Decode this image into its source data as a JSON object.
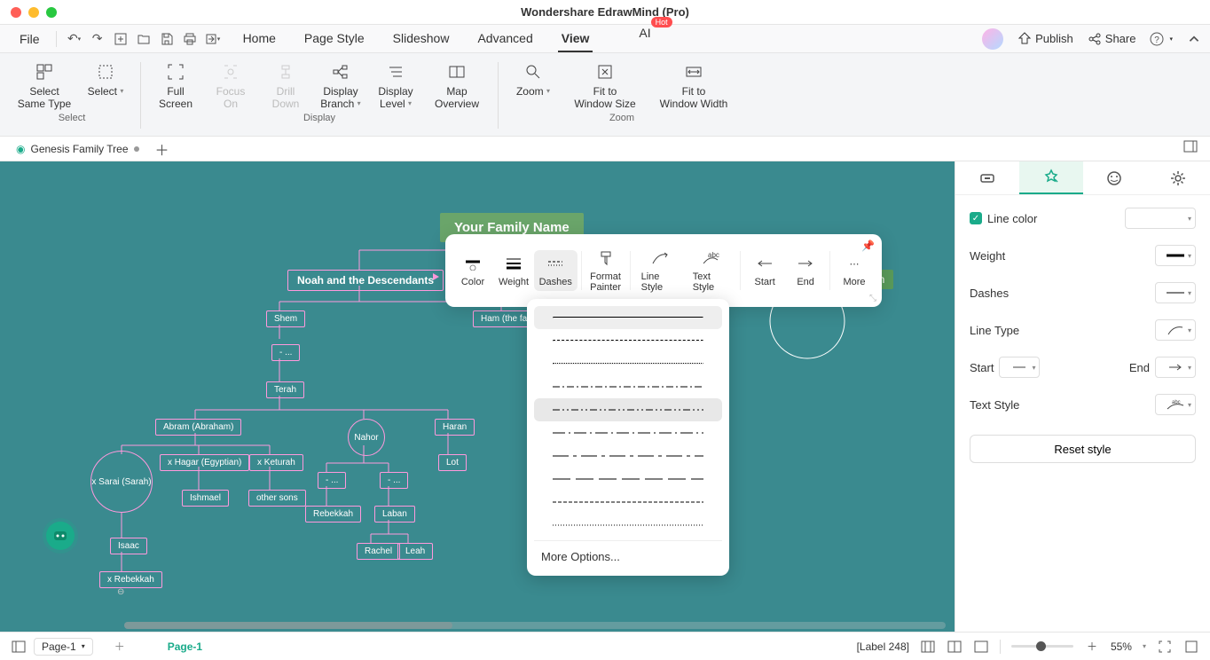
{
  "app_title": "Wondershare EdrawMind (Pro)",
  "menu": {
    "file": "File",
    "tabs": [
      "Home",
      "Page Style",
      "Slideshow",
      "Advanced",
      "View",
      "AI"
    ],
    "active_tab": "View",
    "ai_badge": "Hot",
    "publish": "Publish",
    "share": "Share"
  },
  "ribbon": {
    "groups": [
      {
        "label": "Select",
        "items": [
          {
            "label": "Select\nSame Type",
            "icon": "select-same"
          },
          {
            "label": "Select",
            "icon": "select",
            "caret": true
          }
        ]
      },
      {
        "label": "Display",
        "items": [
          {
            "label": "Full\nScreen",
            "icon": "fullscreen"
          },
          {
            "label": "Focus\nOn",
            "icon": "focus",
            "disabled": true
          },
          {
            "label": "Drill\nDown",
            "icon": "drill",
            "disabled": true
          },
          {
            "label": "Display\nBranch",
            "icon": "branch",
            "caret": true
          },
          {
            "label": "Display\nLevel",
            "icon": "level",
            "caret": true
          },
          {
            "label": "Map\nOverview",
            "icon": "overview"
          }
        ]
      },
      {
        "label": "Zoom",
        "items": [
          {
            "label": "Zoom",
            "icon": "zoom",
            "caret": true
          },
          {
            "label": "Fit to\nWindow Size",
            "icon": "fit-size"
          },
          {
            "label": "Fit to\nWindow Width",
            "icon": "fit-width"
          }
        ]
      }
    ]
  },
  "doc_tab": {
    "name": "Genesis Family Tree",
    "modified": true
  },
  "canvas": {
    "root": "Your Family Name",
    "major": [
      "Noah and the Descendants"
    ],
    "right_hidden": "on",
    "nodes": {
      "shem": "Shem",
      "ham": "Ham (the fat",
      "dash1": "- ...",
      "terah": "Terah",
      "abram": "Abram (Abraham)",
      "nahor": "Nahor",
      "haran": "Haran",
      "sarai": "x Sarai (Sarah)",
      "hagar": "x Hagar (Egyptian)",
      "keturah": "x Keturah",
      "ishmael": "Ishmael",
      "othersons": "other sons",
      "dash2": "- ...",
      "dash3": "- ...",
      "rebekkah": "Rebekkah",
      "laban": "Laban",
      "lot": "Lot",
      "isaac": "Isaac",
      "xrebekkah": "x Rebekkah",
      "rachel": "Rachel",
      "leah": "Leah"
    }
  },
  "float_toolbar": {
    "items": [
      "Color",
      "Weight",
      "Dashes",
      "Format\nPainter",
      "Line Style",
      "Text Style",
      "Start",
      "End",
      "More"
    ],
    "active": "Dashes"
  },
  "dashes_dropdown": {
    "options_count": 10,
    "selected_index": 0,
    "hover_index": 4,
    "more": "More Options..."
  },
  "right_panel": {
    "tabs": [
      "topic",
      "style",
      "emoji",
      "settings"
    ],
    "active_tab": 1,
    "line_color": "Line color",
    "line_color_checked": true,
    "weight": "Weight",
    "dashes": "Dashes",
    "line_type": "Line Type",
    "start": "Start",
    "end": "End",
    "text_style": "Text Style",
    "reset": "Reset style"
  },
  "status": {
    "page_select": "Page-1",
    "page_tab": "Page-1",
    "label": "[Label 248]",
    "zoom": "55%"
  },
  "colors": {
    "canvas_bg": "#3a8a8f",
    "accent": "#1aab8a",
    "node_border": "#ff99dd"
  }
}
